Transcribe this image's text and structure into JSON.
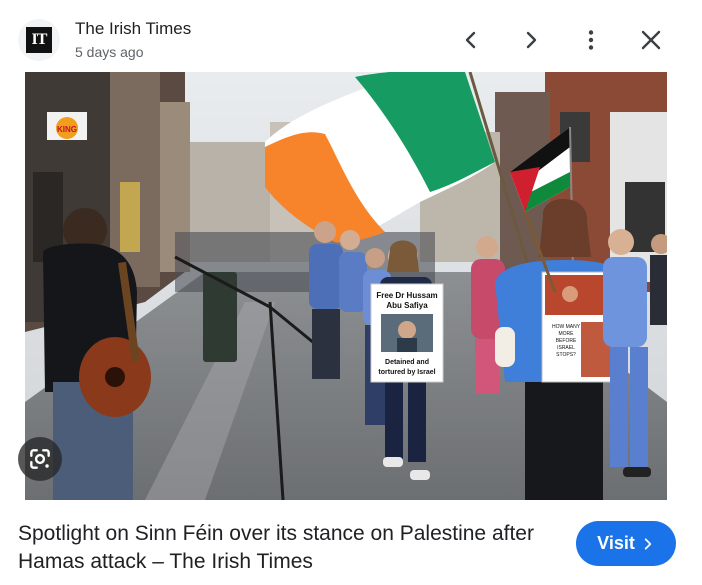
{
  "source": {
    "name": "The Irish Times",
    "logo_text": "IT",
    "timestamp": "5 days ago"
  },
  "toolbar": {
    "icons": [
      "chevron-left-icon",
      "chevron-right-icon",
      "more-vert-icon",
      "close-icon"
    ]
  },
  "image": {
    "signs": {
      "shop_sign": "KING",
      "placard_line1": "Free Dr Hussam",
      "placard_line2": "Abu Safiya",
      "placard_line3": "Detained and",
      "placard_line4": "tortured by Israel",
      "placard2_line1": "HOW MANY",
      "placard2_line2": "MORE",
      "placard2_line3": "BEFORE",
      "placard2_line4": "ISRAEL",
      "placard2_line5": "STOPS?"
    },
    "lens_icon": "google-lens-icon"
  },
  "caption": "Spotlight on Sinn Féin over its stance on Palestine after Hamas attack – The Irish Times",
  "visit_button": {
    "label": "Visit",
    "icon": "chevron-right-icon",
    "color": "#1a73e8"
  }
}
